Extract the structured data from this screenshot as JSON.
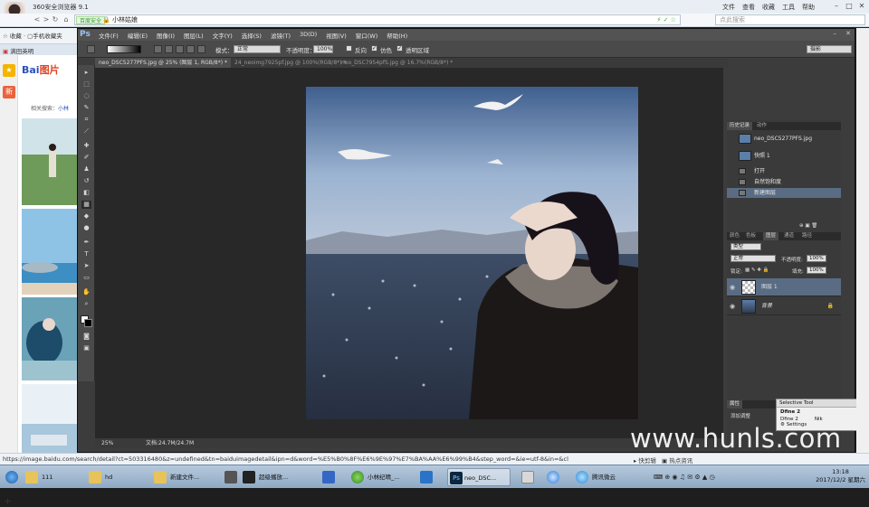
{
  "browser": {
    "title": "360安全浏览器 9.1",
    "menus": [
      "文件",
      "查看",
      "收藏",
      "工具",
      "帮助"
    ],
    "secure_label": "百度安全",
    "address": "小林姑娘",
    "search_placeholder": "点此搜索",
    "bookmark_label": "收藏",
    "bookmark_item": "手机收藏夹",
    "tab_label": "满田英明",
    "status_url": "https://image.baidu.com/search/detail?ct=503316480&z=undefined&tn=baiduimagedetail&ipn=d&word=%E5%B0%8F%E6%9E%97%E7%BA%AA%E6%99%B4&step_word=&ie=utf-8&in=&cl",
    "status_right": [
      "快剪辑",
      "热点资讯"
    ]
  },
  "baidu": {
    "logo_a": "Bai",
    "logo_b": "图片",
    "related_prefix": "相关搜索：",
    "related_link": "小林"
  },
  "photoshop": {
    "logo": "Ps",
    "menus": [
      "文件(F)",
      "编辑(E)",
      "图像(I)",
      "图层(L)",
      "文字(Y)",
      "选择(S)",
      "滤镜(T)",
      "3D(D)",
      "视图(V)",
      "窗口(W)",
      "帮助(H)"
    ],
    "options": {
      "mode_label": "模式：",
      "mode_value": "正常",
      "opacity_label": "不透明度：",
      "opacity_value": "100%",
      "reverse": "反向",
      "dither": "仿色",
      "transparency": "透明区域",
      "workspace": "摄影"
    },
    "doc_tabs": [
      "neo_DSC5277PFS.jpg @ 25% (图层 1, RGB/8*) *",
      "24_neoimg7925pf.jpg @ 100%(RGB/8*) *",
      "neo_DSC7954pfS.jpg @ 16.7%(RGB/8*) *"
    ],
    "status": {
      "zoom": "25%",
      "doc": "文档:24.7M/24.7M"
    },
    "history": {
      "tabs": [
        "历史记录",
        "动作"
      ],
      "snapshot_name": "neo_DSC5277PFS.jpg",
      "snapshot2": "快照 1",
      "steps": [
        "打开",
        "自然饱和度",
        "新建图层"
      ]
    },
    "layers": {
      "tabs": [
        "颜色",
        "色板",
        "图层",
        "通道",
        "路径"
      ],
      "kind": "类型",
      "blend": "正常",
      "opacity_label": "不透明度:",
      "opacity": "100%",
      "lock_label": "锁定:",
      "fill_label": "填充:",
      "fill": "100%",
      "items": [
        "图层 1",
        "背景"
      ]
    },
    "adjust": {
      "tab": "属性",
      "label": "添加调整"
    }
  },
  "selective_tool": {
    "title": "Selective Tool",
    "app": "Dfine 2",
    "row": "Dfine 2",
    "row_extra": "Nik",
    "settings": "Settings"
  },
  "watermark": "www.hunls.com",
  "taskbar": {
    "items": [
      "111",
      "hd",
      "新建文件...",
      "超级播放...",
      "小林纪晴_...",
      "neo_DSC...",
      "腾讯微云"
    ],
    "time": "13:18",
    "date": "2017/12/2 星期六"
  },
  "colors": {
    "ps_bg": "#282828",
    "ps_panel": "#3a3a3a",
    "ps_select": "#596c84",
    "accent_blue": "#2a52be",
    "baidu_red": "#d42"
  }
}
